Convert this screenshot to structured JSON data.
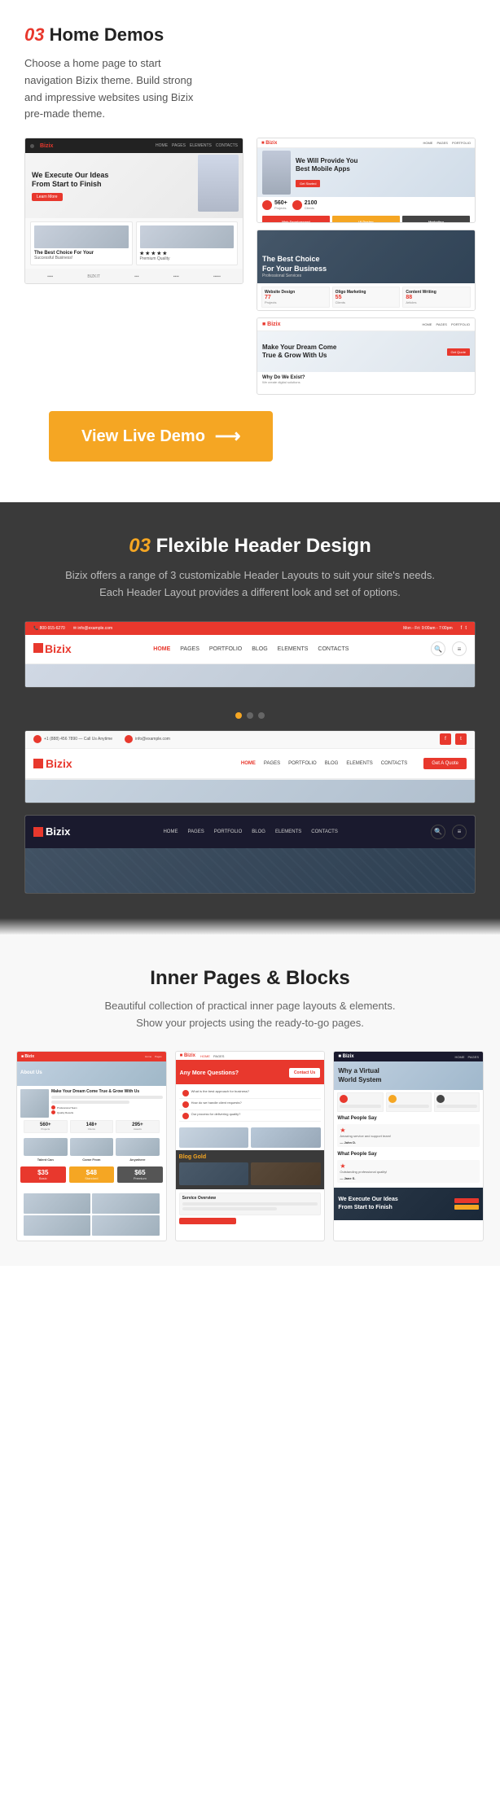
{
  "section1": {
    "number": "03",
    "title": "Home Demos",
    "description": "Choose a home page to start navigation Bizix theme. Build strong and impressive websites using Bizix pre-made theme.",
    "demo_button": "View Live Demo"
  },
  "section2": {
    "number": "03",
    "title": "Flexible Header Design",
    "description": "Bizix offers a range of 3 customizable Header Layouts to suit your site's needs. Each Header Layout provides a different look and set of options.",
    "header1": {
      "phone": "800-915-6270",
      "email": "info@example.com",
      "hours": "Mon - Fri: 9:00am - 7:00pm",
      "logo": "Bizix",
      "nav_items": [
        "HOME",
        "PAGES",
        "PORTFOLIO",
        "BLOG",
        "ELEMENTS",
        "CONTACTS"
      ]
    },
    "header2": {
      "phone": "+1 (888) 456 7890",
      "phone_label": "Call Us Anytime",
      "email": "info@example.com",
      "logo": "Bizix",
      "nav_items": [
        "HOME",
        "PAGES",
        "PORTFOLIO",
        "BLOG",
        "ELEMENTS",
        "CONTACTS"
      ],
      "cta": "Get A Quote"
    },
    "header3": {
      "logo": "Bizix",
      "nav_items": [
        "HOME",
        "PAGES",
        "PORTFOLIO",
        "BLOG",
        "ELEMENTS",
        "CONTACTS"
      ]
    }
  },
  "section3": {
    "title": "Inner Pages & Blocks",
    "description": "Beautiful collection of practical inner page layouts & elements.\nShow your projects using the ready-to-go pages.",
    "pages": [
      {
        "type": "about"
      },
      {
        "type": "faq"
      },
      {
        "type": "team"
      },
      {
        "type": "services"
      },
      {
        "type": "blog"
      },
      {
        "type": "portfolio"
      },
      {
        "type": "pricing"
      },
      {
        "type": "contact"
      },
      {
        "type": "testimonials"
      }
    ]
  },
  "colors": {
    "red": "#e8382d",
    "orange": "#f5a623",
    "dark": "#3a3a3a",
    "dark_navy": "#1a1a2e"
  }
}
